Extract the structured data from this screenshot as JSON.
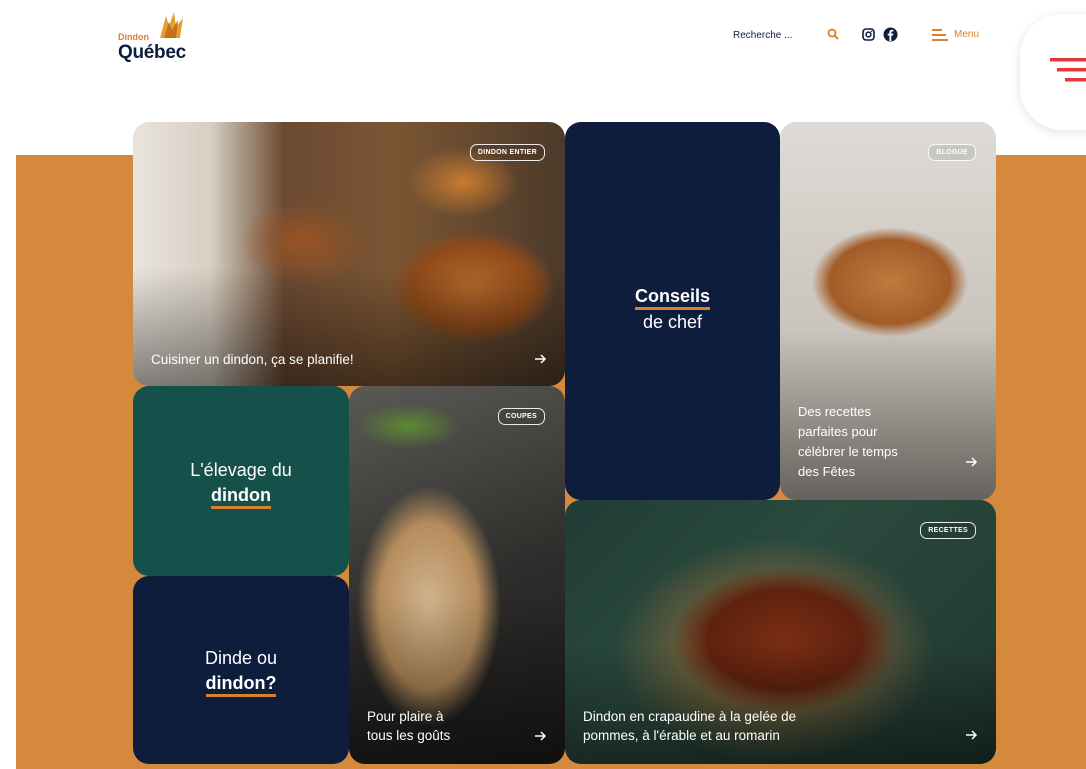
{
  "header": {
    "logo_small": "Dindon",
    "logo_big": "Québec",
    "search_placeholder": "Recherche ...",
    "menu_label": "Menu"
  },
  "icons": {
    "search": "search-icon",
    "instagram": "instagram-icon",
    "facebook": "facebook-icon",
    "menu": "hamburger-icon",
    "arrow": "arrow-right-icon"
  },
  "colors": {
    "accent_orange": "#d5893c",
    "navy": "#0f1d3d",
    "green": "#16504a"
  },
  "tiles": {
    "whole_turkey": {
      "badge": "DINDON ENTIER",
      "caption": "Cuisiner un dindon, ça se planifie!"
    },
    "chef_tips": {
      "line1": "Conseils",
      "line2": "de chef"
    },
    "blog": {
      "badge": "BLOGUE",
      "caption_l1": "Des recettes",
      "caption_l2": "parfaites pour",
      "caption_l3": "célébrer le temps",
      "caption_l4": "des Fêtes"
    },
    "raising": {
      "line1": "L'élevage du",
      "line2": "dindon"
    },
    "cuts": {
      "badge": "COUPES",
      "caption_l1": "Pour plaire à",
      "caption_l2": "tous les goûts"
    },
    "recipes": {
      "badge": "RECETTES",
      "caption_l1": "Dindon en crapaudine à la gelée de",
      "caption_l2": "pommes, à l'érable et au romarin"
    },
    "dinde": {
      "line1": "Dinde ou",
      "line2": "dindon?"
    }
  }
}
